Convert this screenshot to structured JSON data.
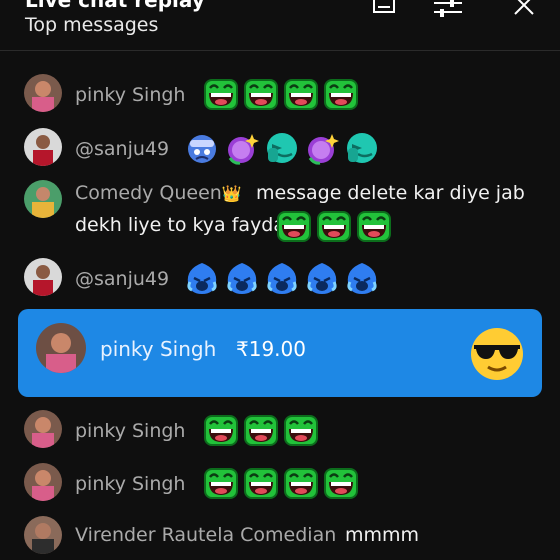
{
  "header": {
    "cut_title": "Live chat replay",
    "subtitle": "Top messages"
  },
  "messages": [
    {
      "author": "pinky Singh",
      "emojis": [
        "laughing-frog",
        "laughing-frog",
        "laughing-frog",
        "laughing-frog"
      ]
    },
    {
      "author": "@sanju49",
      "emojis": [
        "blue-face",
        "purple-sparkle",
        "teal-hand",
        "purple-sparkle",
        "teal-hand"
      ]
    },
    {
      "author": "Comedy Queen",
      "badge": "👑",
      "text_line1": "message delete kar diye jab",
      "text_line2": "dekh liye to kya fayda",
      "emojis": [
        "laughing-frog",
        "laughing-frog",
        "laughing-frog"
      ]
    },
    {
      "author": "@sanju49",
      "emojis": [
        "crying-blue",
        "crying-blue",
        "crying-blue",
        "crying-blue",
        "crying-blue"
      ]
    },
    {
      "author": "pinky Singh",
      "emojis": [
        "laughing-frog",
        "laughing-frog",
        "laughing-frog"
      ]
    },
    {
      "author": "pinky Singh",
      "emojis": [
        "laughing-frog",
        "laughing-frog",
        "laughing-frog",
        "laughing-frog"
      ]
    },
    {
      "author": "Virender Rautela Comedian",
      "text": "mmmm"
    }
  ],
  "superchat": {
    "author": "pinky Singh",
    "amount": "₹19.00",
    "sticker": "sunglasses-face"
  },
  "colors": {
    "background": "#0f0f0f",
    "superchat": "#1e88e5",
    "author": "#aaaaaa",
    "frog_green": "#2ecc40"
  }
}
